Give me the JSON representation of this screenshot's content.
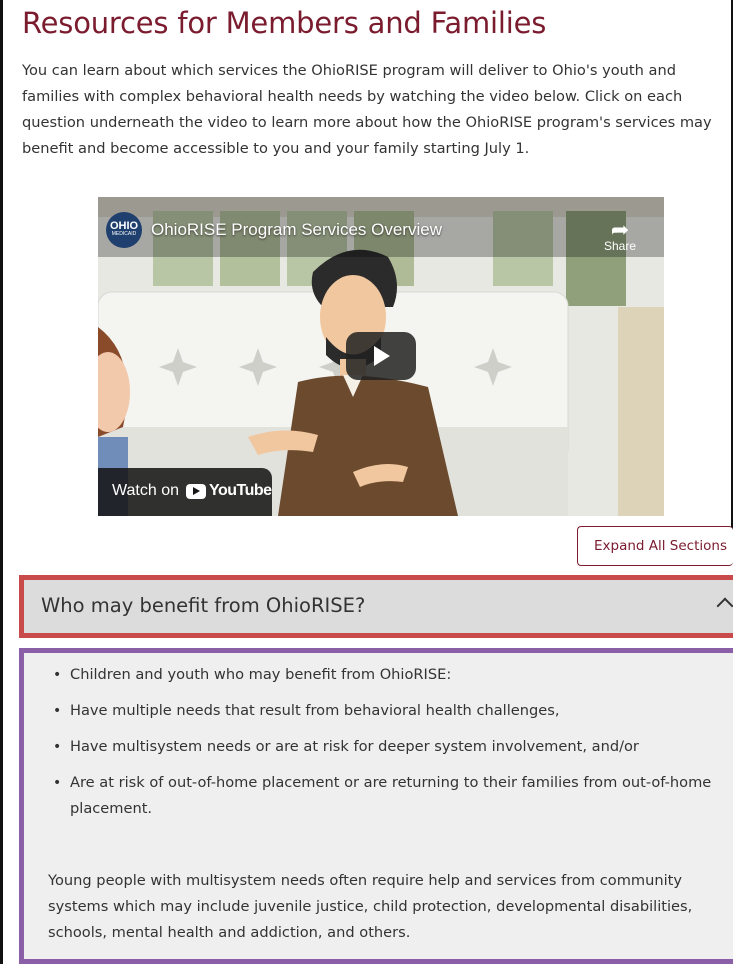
{
  "page": {
    "title": "Resources for Members and Families",
    "intro": "You can learn about which services the OhioRISE program will deliver to Ohio's youth and families with complex behavioral health needs by watching the video below. Click on each question underneath the video to learn more about how the OhioRISE program's services may benefit and become accessible to you and your family starting July 1."
  },
  "video": {
    "channel_logo_line1": "OHIO",
    "channel_logo_line2": "MEDICAID",
    "title": "OhioRISE Program Services Overview",
    "share_label": "Share",
    "watch_on_label": "Watch on",
    "youtube_label": "YouTube"
  },
  "accordion": {
    "expand_all_label": "Expand All Sections",
    "section_title": "Who may benefit from OhioRISE?",
    "bullets": [
      "Children and youth who may benefit from OhioRISE:",
      "Have multiple needs that result from behavioral health challenges,",
      "Have multisystem needs or are at risk for deeper system involvement, and/or",
      "Are at risk of out-of-home placement or are returning to their families from out-of-home placement."
    ],
    "paragraph": "Young people with multisystem needs often require help and services from community systems which may include juvenile justice, child protection, developmental disabilities, schools, mental health and addiction, and others."
  },
  "colors": {
    "heading": "#7a1b2e",
    "header_highlight": "#c94a4a",
    "content_highlight": "#8a5fa8",
    "accordion_bg": "#dcdcdc"
  },
  "icons": [
    "chevron-up-icon",
    "share-icon",
    "play-icon",
    "youtube-icon"
  ]
}
